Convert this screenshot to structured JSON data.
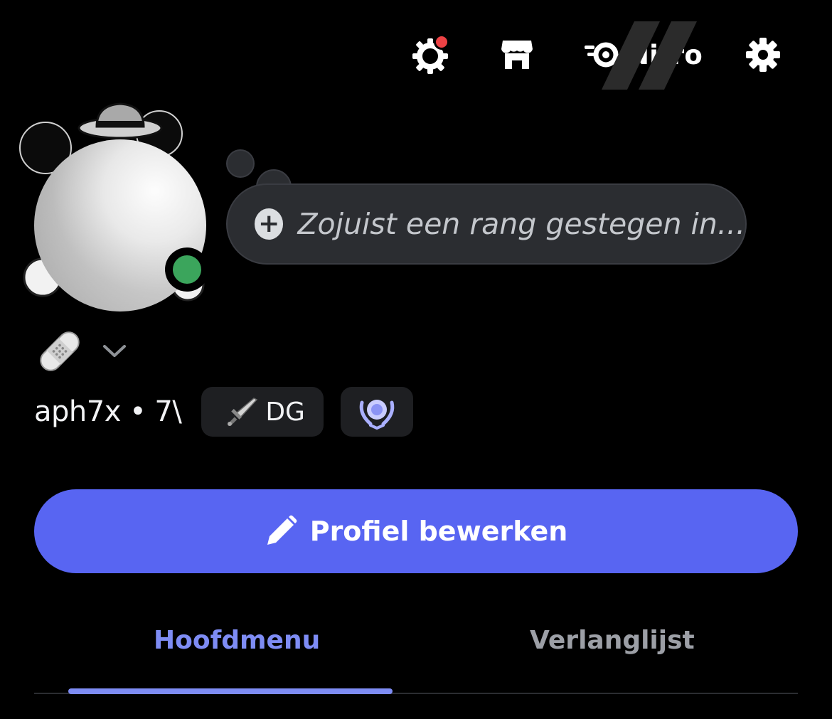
{
  "header": {
    "icons": [
      "quests-icon",
      "shop-icon",
      "nitro-icon",
      "settings-icon"
    ],
    "nitro_label": "Nitro",
    "has_notification": true
  },
  "profile": {
    "status_placeholder": "Zojuist een rang gestegen in...",
    "presence": "online",
    "presence_color": "#3ba55c",
    "username_line": "aph7x • 7\\",
    "clan_tag": "DG",
    "clan_icon": "sword-icon",
    "badge_icon": "laurel-badge-icon"
  },
  "actions": {
    "edit_profile": "Profiel bewerken"
  },
  "tabs": [
    {
      "label": "Hoofdmenu",
      "active": true
    },
    {
      "label": "Verlanglijst",
      "active": false
    }
  ],
  "colors": {
    "accent": "#5865f2",
    "active_tab": "#7e8cf4",
    "background": "#000000",
    "surface": "#2b2d31"
  }
}
